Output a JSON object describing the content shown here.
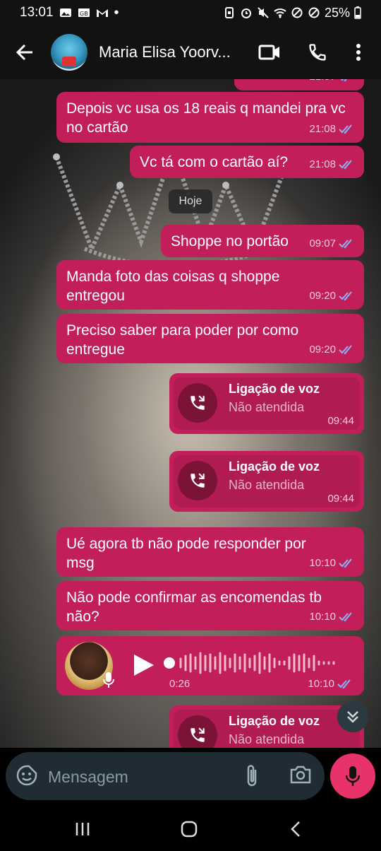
{
  "status_bar": {
    "time": "13:01",
    "left_icons": [
      "gallery-icon",
      "sim-icon",
      "gmail-icon",
      "dot-icon"
    ],
    "right_icons": [
      "nfc-icon",
      "alarm-icon",
      "mute-icon",
      "wifi-icon",
      "no-disturb-icon",
      "block-icon"
    ],
    "battery": "25%"
  },
  "header": {
    "contact_name": "Maria Elisa Yoorv...",
    "icons": [
      "back-arrow-icon",
      "video-call-icon",
      "phone-icon",
      "more-vert-icon"
    ]
  },
  "messages": [
    {
      "text": "Depois vc usa os 18 reais q mandei pra vc no cartão",
      "time": "21:08"
    },
    {
      "text": "Vc tá com o cartão aí?",
      "time": "21:08"
    },
    {
      "text": "Shoppe no portão",
      "time": "09:07"
    },
    {
      "text": "Manda foto das coisas q shoppe entregou",
      "time": "09:20"
    },
    {
      "text": "Preciso saber para poder por como entregue",
      "time": "09:20"
    },
    {
      "text": "Ué agora tb não pode responder por msg",
      "time": "10:10"
    },
    {
      "text": "Não pode confirmar as encomendas tb não?",
      "time": "10:10"
    }
  ],
  "partial_top_time": "21:07",
  "date_separator": "Hoje",
  "calls": [
    {
      "title": "Ligação de voz",
      "status": "Não atendida",
      "time": "09:44"
    },
    {
      "title": "Ligação de voz",
      "status": "Não atendida",
      "time": "09:44"
    },
    {
      "title": "Ligação de voz",
      "status": "Não atendida",
      "time": ""
    }
  ],
  "audio": {
    "duration": "0:26",
    "time": "10:10"
  },
  "composer": {
    "placeholder": "Mensagem"
  },
  "colors": {
    "bubble": "#c21f5a",
    "header": "#121212",
    "accent_mic": "#e8336a",
    "ticks": "#8ab4f8"
  }
}
